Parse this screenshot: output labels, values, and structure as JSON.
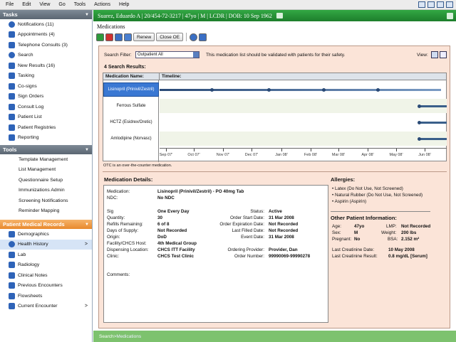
{
  "menu": [
    "File",
    "Edit",
    "View",
    "Go",
    "Tools",
    "Actions",
    "Help"
  ],
  "sidebar": {
    "tasks_header": "Tasks",
    "tasks": [
      {
        "label": "Notifications (11)"
      },
      {
        "label": "Appointments (4)"
      },
      {
        "label": "Telephone Consults (3)"
      },
      {
        "label": "Search"
      },
      {
        "label": "New Results (16)"
      },
      {
        "label": "Tasking"
      },
      {
        "label": "Co-signs"
      },
      {
        "label": "Sign Orders"
      },
      {
        "label": "Consult Log"
      },
      {
        "label": "Patient List"
      },
      {
        "label": "Patient Registries"
      },
      {
        "label": "Reporting"
      }
    ],
    "tools_header": "Tools",
    "tools": [
      {
        "label": "Template Management"
      },
      {
        "label": "List Management"
      },
      {
        "label": "Questionnaire Setup"
      },
      {
        "label": "Immunizations Admin"
      },
      {
        "label": "Screening Notifications"
      },
      {
        "label": "Reminder Mapping"
      }
    ],
    "pmr_header": "Patient Medical Records",
    "pmr": [
      {
        "label": "Demographics"
      },
      {
        "label": "Health History",
        "chev": ">"
      },
      {
        "label": "Lab"
      },
      {
        "label": "Radiology"
      },
      {
        "label": "Clinical Notes"
      },
      {
        "label": "Previous Encounters"
      },
      {
        "label": "Flowsheets"
      },
      {
        "label": "Current Encounter",
        "chev": ">"
      }
    ]
  },
  "banner": "Suarez, Eduardo A | 20/454-72-3217 | 47yo | M | LCDR | DOB: 10 Sep 1962",
  "page_title": "Medications",
  "toolbar": {
    "renew": "Renew",
    "close_oe": "Close OE"
  },
  "filter": {
    "label": "Search Filter:",
    "value": "Outpatient All",
    "note": "This medication list should be validated with patients for their safety.",
    "view_label": "View:"
  },
  "results_label": "4 Search Results:",
  "grid": {
    "col_med": "Medication Name:",
    "col_timeline": "Timeline:",
    "meds": [
      "Lisinopril (Prinivil/Zestril)",
      "Ferrous Sulfate",
      "HCTZ (Esidrex/Oretic)",
      "Amlodipine (Norvasc)"
    ],
    "ticks": [
      "Sep 07'",
      "Oct 07'",
      "Nov 07'",
      "Dec 07'",
      "Jan 08'",
      "Feb 08'",
      "Mar 08'",
      "Apr 08'",
      "May 08'",
      "Jun 08'"
    ]
  },
  "otc_note": "OTC is an over-the-counter medication.",
  "details": {
    "title": "Medication Details:",
    "medication_label": "Medication:",
    "medication": "Lisinopril (Prinivil/Zestril) - PO 40mg Tab",
    "ndc_label": "NDC:",
    "ndc": "No NDC",
    "left": [
      {
        "label": "Sig",
        "value": "One Every Day"
      },
      {
        "label": "Quantity:",
        "value": "30"
      },
      {
        "label": "Refills Remaining:",
        "value": "6 of 8"
      },
      {
        "label": "Days of Supply:",
        "value": "Not Recorded"
      },
      {
        "label": "Origin:",
        "value": "DoD"
      },
      {
        "label": "Facility/CHCS Host:",
        "value": "4th Medical Group"
      },
      {
        "label": "Dispensing Location:",
        "value": "CHCS ITT Facility"
      },
      {
        "label": "Clinic:",
        "value": "CHCS Test Clinic"
      }
    ],
    "right": [
      {
        "label": "Status:",
        "value": "Active"
      },
      {
        "label": "Order Start Date:",
        "value": "31 Mar 2008"
      },
      {
        "label": "Order Expiration Date:",
        "value": "Not Recorded"
      },
      {
        "label": "Last Filled Date:",
        "value": "Not Recorded"
      },
      {
        "label": "Event Date:",
        "value": "31 Mar 2008"
      },
      {
        "label": "Ordering Provider:",
        "value": "Provider, Dan"
      },
      {
        "label": "Order Number:",
        "value": "99990069-99990278"
      }
    ],
    "comments_label": "Comments:"
  },
  "allergies": {
    "title": "Allergies:",
    "items": [
      "• Latex (Do Not Use, Not Screened)",
      "• Natural Rubber (Do Not Use, Not Screened)",
      "• Aspirin (Aspirin)"
    ]
  },
  "other_info": {
    "title": "Other Patient Information:",
    "age_label": "Age:",
    "age": "47yo",
    "lmp_label": "LMP:",
    "lmp": "Not Recorded",
    "sex_label": "Sex:",
    "sex": "M",
    "weight_label": "Weight:",
    "weight": "200 lbs",
    "pregnant_label": "Pregnant:",
    "pregnant": "No",
    "bsa_label": "BSA:",
    "bsa": "2.152 m²",
    "creat_date_label": "Last Creatinine Date:",
    "creat_date": "10 May 2008",
    "creat_result_label": "Last Creatinine Result:",
    "creat_result": "0.8 mg/dL [Serum]"
  },
  "footer": {
    "crumb1": "Search",
    "sep": " > ",
    "crumb2": "Medications"
  },
  "colors": {
    "banner": "#1d7e2c",
    "panel": "#fbe4d8",
    "selected": "#3a78d3",
    "pmr_header": "#e8892d"
  }
}
